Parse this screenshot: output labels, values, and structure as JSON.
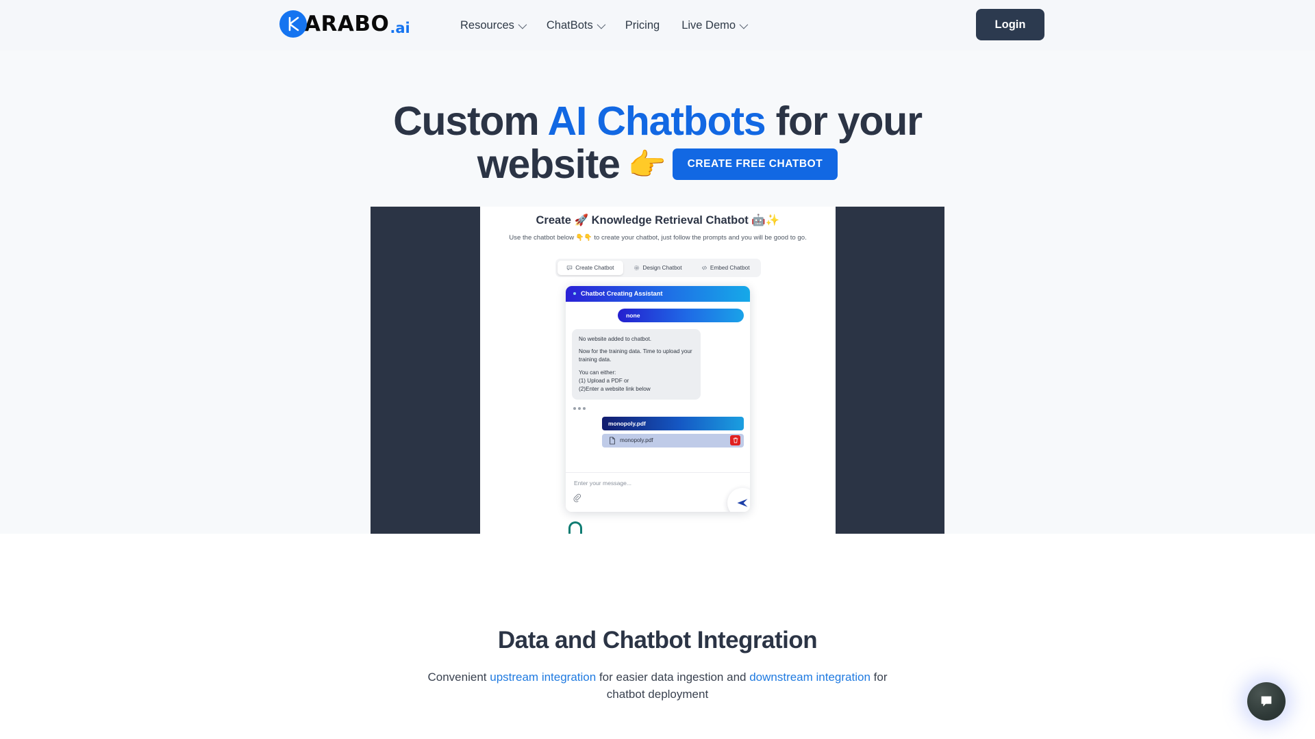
{
  "header": {
    "logo": {
      "k": "K",
      "word": "ARABO",
      "suffix": ".ai"
    },
    "nav": [
      {
        "label": "Resources",
        "has_caret": true
      },
      {
        "label": "ChatBots",
        "has_caret": true
      },
      {
        "label": "Pricing",
        "has_caret": false
      },
      {
        "label": "Live Demo",
        "has_caret": true
      }
    ],
    "login_label": "Login"
  },
  "hero": {
    "line1_a": "Custom ",
    "line1_blue": "AI Chatbots",
    "line1_b": " for your",
    "line2": "website",
    "point_emoji": "👉",
    "cta_label": "CREATE FREE CHATBOT"
  },
  "demo": {
    "title": "Create 🚀 Knowledge Retrieval Chatbot 🤖✨",
    "subtitle": "Use the chatbot below 👇👇 to create your chatbot, just follow the prompts and you will be good to go.",
    "tabs": [
      {
        "label": "Create Chatbot",
        "icon": "chat-icon",
        "active": true
      },
      {
        "label": "Design Chatbot",
        "icon": "gear-icon",
        "active": false
      },
      {
        "label": "Embed Chatbot",
        "icon": "code-icon",
        "active": false
      }
    ],
    "chat": {
      "header_title": "Chatbot Creating Assistant",
      "user_message": "none",
      "bot_lines": [
        "No website added to chatbot.",
        "Now for the training data. Time to upload your training data.",
        "You can either:\n(1) Upload a PDF or\n(2)Enter a website link below"
      ],
      "uploaded_message": "monopoly.pdf",
      "file_chip_name": "monopoly.pdf",
      "input_placeholder": "Enter your message..."
    }
  },
  "section2": {
    "title": "Data and Chatbot Integration",
    "sub_a": "Convenient ",
    "link1": "upstream integration",
    "sub_b": " for easier data ingestion and ",
    "link2": "downstream integration",
    "sub_c": " for chatbot deployment"
  },
  "widget": {
    "icon": "chat-bubble-icon"
  },
  "colors": {
    "accent_blue": "#1268e3",
    "logo_blue": "#1574f0",
    "dark_navy": "#2b3445",
    "login_navy": "#2c3a4f",
    "link_blue": "#1f7ae0",
    "page_bg": "#f7f9fb",
    "danger_red": "#e02020",
    "teal": "#0e7c72"
  }
}
